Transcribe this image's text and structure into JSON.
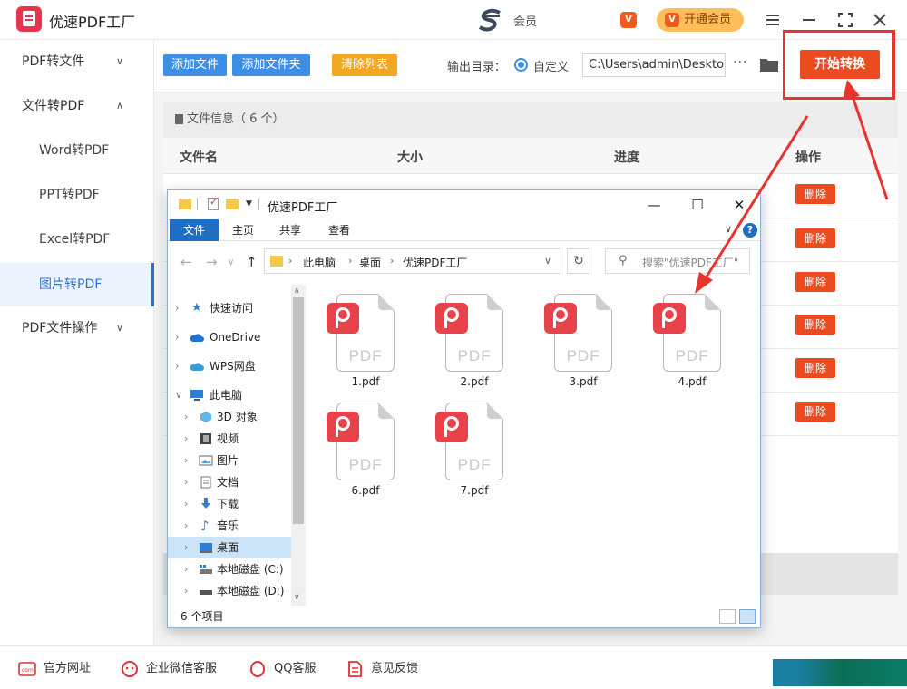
{
  "app": {
    "title": "优速PDF工厂",
    "member_text": "会员",
    "vip_label": "开通会员",
    "vip_badge": "V"
  },
  "sidebar": {
    "items": [
      {
        "label": "PDF转文件",
        "chevron": "chevron-down-icon"
      },
      {
        "label": "文件转PDF",
        "chevron": "chevron-up-icon"
      },
      {
        "label": "Word转PDF"
      },
      {
        "label": "PPT转PDF"
      },
      {
        "label": "Excel转PDF"
      },
      {
        "label": "图片转PDF"
      },
      {
        "label": "PDF文件操作",
        "chevron": "chevron-down-icon"
      }
    ]
  },
  "toolbar": {
    "add_file": "添加文件",
    "add_folder": "添加文件夹",
    "clear_list": "清除列表",
    "output_label": "输出目录：",
    "custom_label": "自定义",
    "path_value": "C:\\Users\\admin\\Deskto",
    "more": "···",
    "start": "开始转换"
  },
  "file_list": {
    "info": "文件信息（ 6 个）",
    "columns": [
      "文件名",
      "大小",
      "进度",
      "操作"
    ],
    "delete_label": "删除"
  },
  "footer": {
    "items": [
      "官方网址",
      "企业微信客服",
      "QQ客服",
      "意见反馈"
    ]
  },
  "explorer": {
    "title": "优速PDF工厂",
    "ribbon": [
      "文件",
      "主页",
      "共享",
      "查看"
    ],
    "address": [
      "此电脑",
      "桌面",
      "优速PDF工厂"
    ],
    "search_placeholder": "搜索\"优速PDF工厂\"",
    "nav": [
      {
        "label": "快速访问",
        "icon": "star-icon"
      },
      {
        "label": "OneDrive",
        "icon": "cloud-icon"
      },
      {
        "label": "WPS网盘",
        "icon": "cloud-icon"
      },
      {
        "label": "此电脑",
        "icon": "computer-icon"
      },
      {
        "label": "3D 对象",
        "icon": "cube-icon"
      },
      {
        "label": "视频",
        "icon": "video-icon"
      },
      {
        "label": "图片",
        "icon": "picture-icon"
      },
      {
        "label": "文档",
        "icon": "document-icon"
      },
      {
        "label": "下载",
        "icon": "download-icon"
      },
      {
        "label": "音乐",
        "icon": "music-icon"
      },
      {
        "label": "桌面",
        "icon": "desktop-icon"
      },
      {
        "label": "本地磁盘 (C:)",
        "icon": "drive-icon"
      },
      {
        "label": "本地磁盘 (D:)",
        "icon": "drive-icon"
      }
    ],
    "files": [
      "1.pdf",
      "2.pdf",
      "3.pdf",
      "4.pdf",
      "6.pdf",
      "7.pdf"
    ],
    "pdf_icon_text": "PDF",
    "status": "6 个项目"
  },
  "colors": {
    "accent": "#3d8ee6",
    "start": "#ec4a1f",
    "clear": "#f4a623",
    "annotation": "#e8342f",
    "pdf": "#e8424a"
  }
}
